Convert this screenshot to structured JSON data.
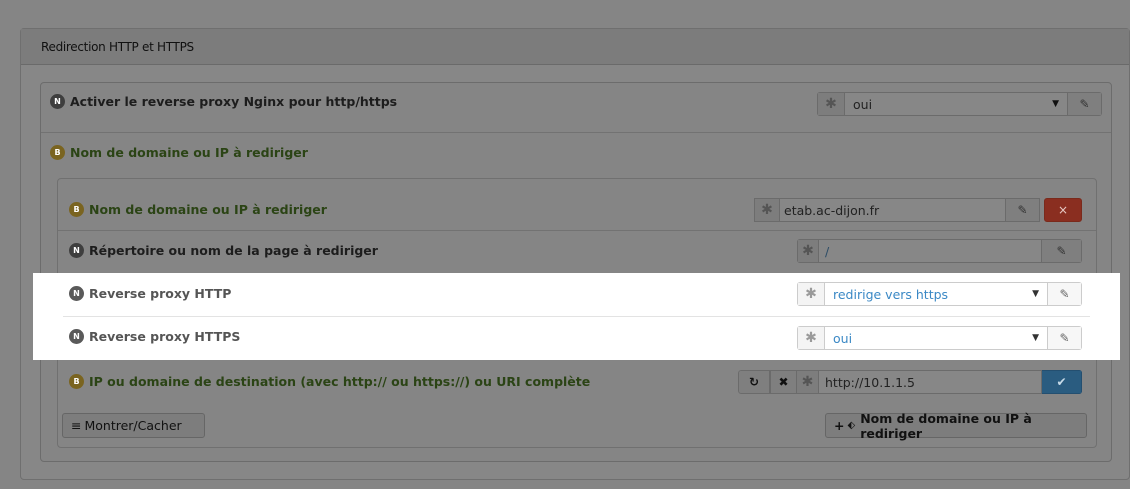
{
  "panel": {
    "title": "Redirection HTTP et HTTPS"
  },
  "rows": {
    "activate": {
      "badge": "N",
      "label": "Activer le reverse proxy Nginx pour http/https",
      "value": "oui"
    },
    "domain_group": {
      "badge": "B",
      "label": "Nom de domaine ou IP à rediriger"
    },
    "domain": {
      "badge": "B",
      "label": "Nom de domaine ou IP à rediriger",
      "value": "etab.ac-dijon.fr"
    },
    "directory": {
      "badge": "N",
      "label": "Répertoire ou nom de la page à rediriger",
      "value": "/"
    },
    "http_proxy": {
      "badge": "N",
      "label": "Reverse proxy HTTP",
      "value": "redirige vers https"
    },
    "https_proxy": {
      "badge": "N",
      "label": "Reverse proxy HTTPS",
      "value": "oui"
    },
    "destination": {
      "badge": "B",
      "label": "IP ou domaine de destination (avec http:// ou https://) ou URI complète",
      "value": "http://10.1.1.5"
    }
  },
  "footer": {
    "toggle_label": "Montrer/Cacher",
    "add_label": "Nom de domaine ou IP à rediriger"
  },
  "icons": {
    "asterisk": "✱",
    "edit": "✎",
    "remove": "×",
    "undo": "↻",
    "clear": "✖",
    "check": "✔",
    "caret": "▼",
    "menu": "≡",
    "plus": "+",
    "tag": "⬖"
  }
}
